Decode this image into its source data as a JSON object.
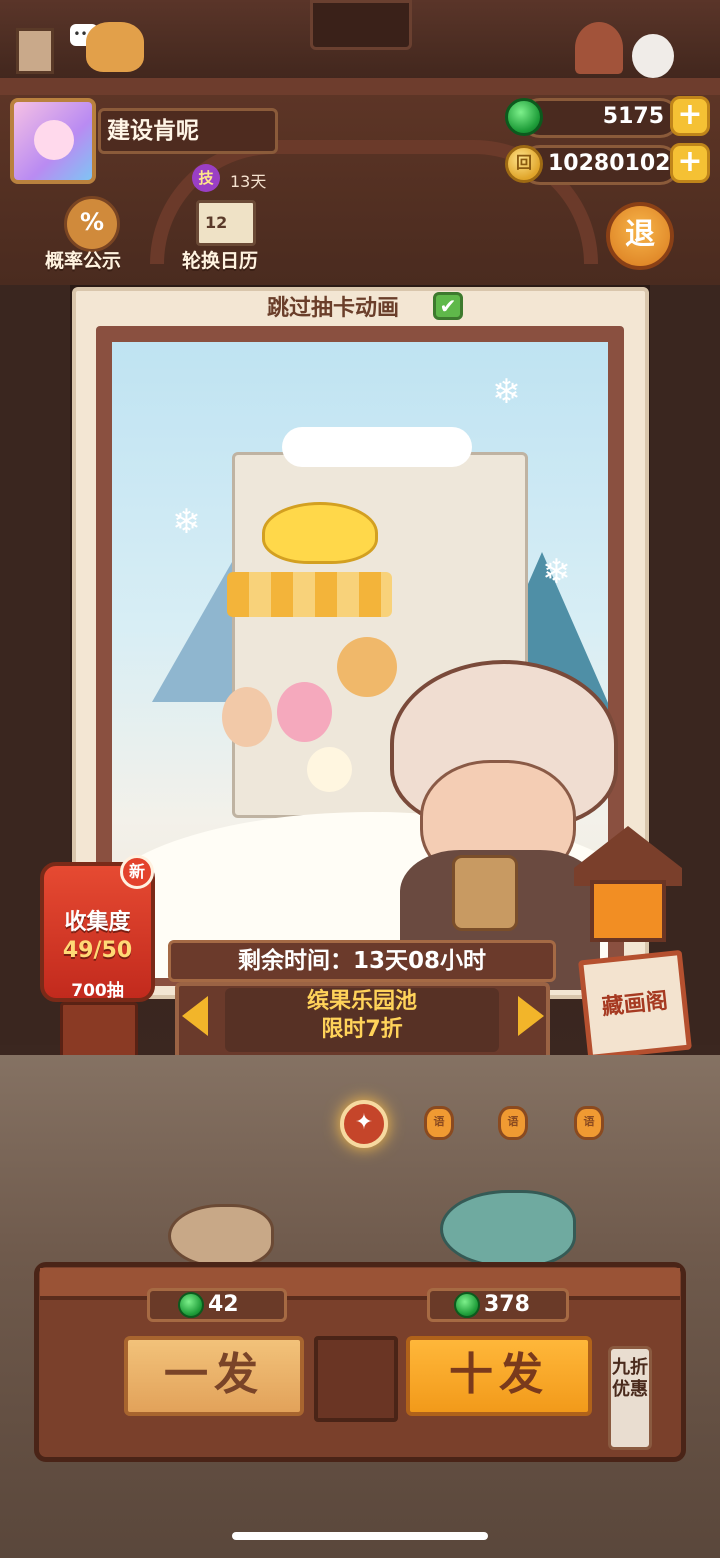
{
  "player": {
    "name": "建设肯呢",
    "skill_badge": "技",
    "skill_days": "13天"
  },
  "currency": {
    "jade": "5175",
    "coins": "10280102",
    "coin_symbol": "回"
  },
  "toolbar": {
    "probability_icon": "%",
    "probability_label": "概率公示",
    "calendar_icon": "12",
    "calendar_label": "轮换日历",
    "exit_label": "退"
  },
  "gacha": {
    "skip_animation_label": "跳过抽卡动画",
    "skip_checked_glyph": "✔",
    "time_remaining": "剩余时间：13天08小时",
    "pool_name": "缤果乐园池",
    "pool_discount": "限时7折"
  },
  "collection": {
    "new_badge": "新",
    "label": "收集度",
    "value": "49/50",
    "draws": "700抽"
  },
  "gallery": {
    "label": "藏画阁"
  },
  "pager": {
    "active_glyph": "✦",
    "dot_glyph": "语",
    "count": 4,
    "active_index": 0
  },
  "draw": {
    "single_label": "一发",
    "single_price": "42",
    "ten_label": "十发",
    "ten_price": "378",
    "discount_tag": "九折优惠"
  },
  "top_deco": {
    "speech": "•••"
  },
  "colors": {
    "accent_gold": "#f5c134",
    "jade_green": "#1f9e3a",
    "wood_dark": "#4a2e22",
    "pool_text": "#ffd35a"
  }
}
